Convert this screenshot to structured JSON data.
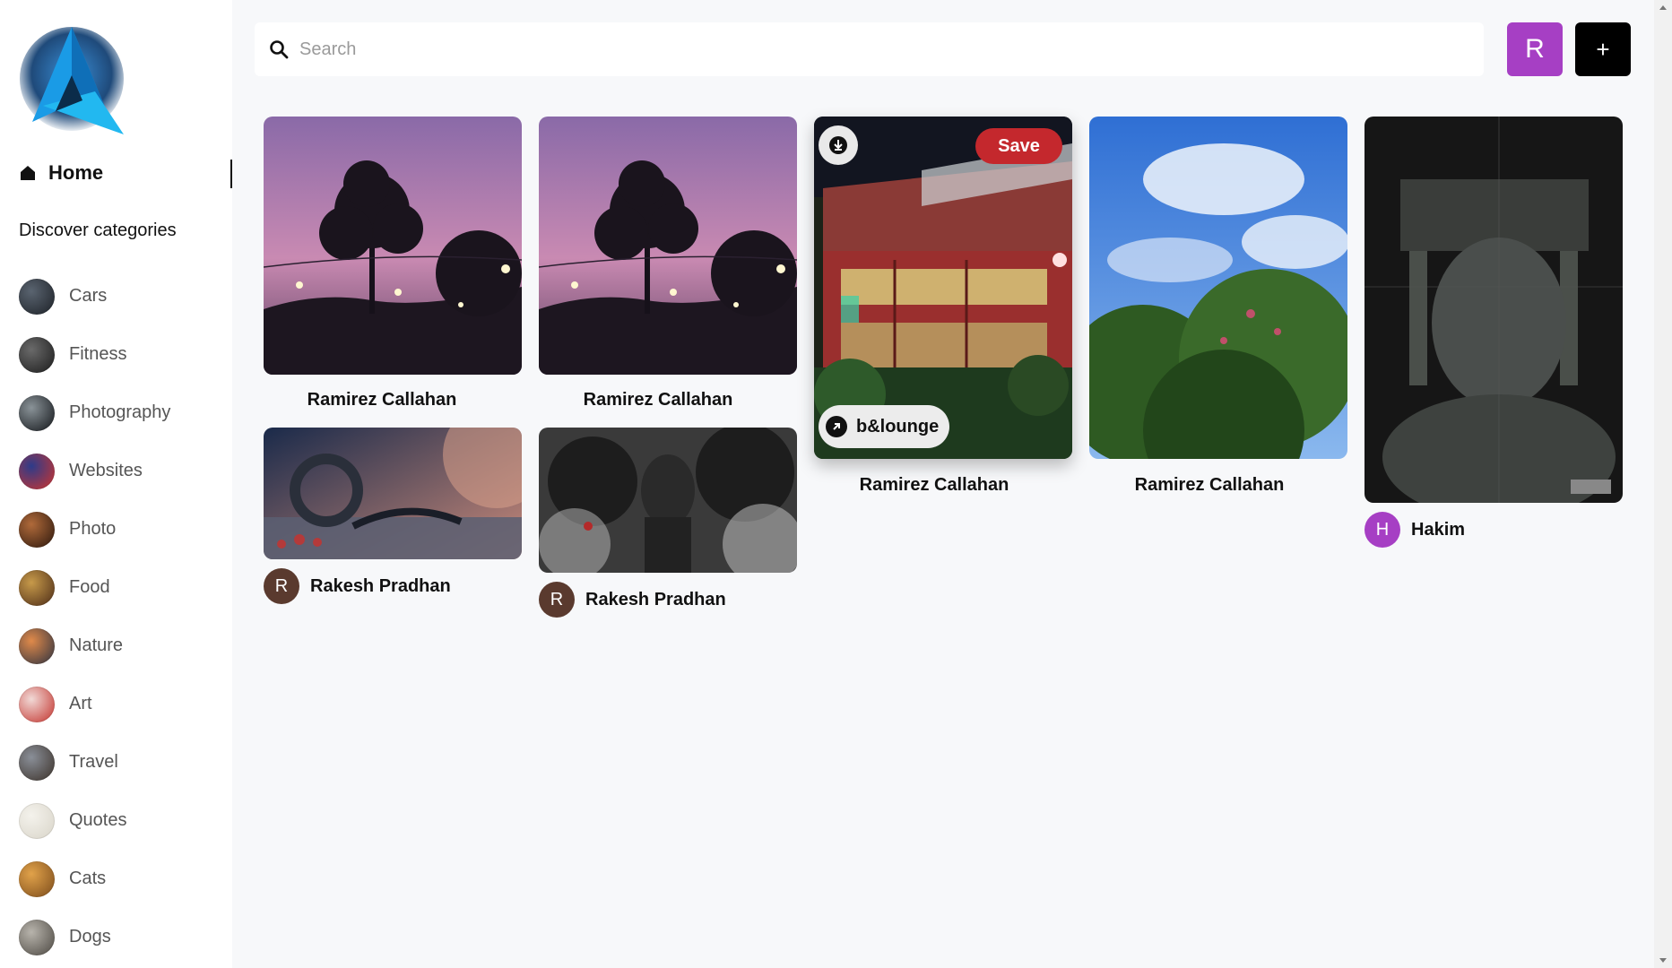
{
  "sidebar": {
    "home_label": "Home",
    "discover_label": "Discover categories",
    "categories": [
      {
        "label": "Cars",
        "icon": "cars-thumbnail",
        "colors": [
          "#5a6470",
          "#1c2026"
        ]
      },
      {
        "label": "Fitness",
        "icon": "fitness-thumbnail",
        "colors": [
          "#6a6a6a",
          "#1a1a1a"
        ]
      },
      {
        "label": "Photography",
        "icon": "photography-thumbnail",
        "colors": [
          "#8a9398",
          "#111418"
        ]
      },
      {
        "label": "Websites",
        "icon": "websites-thumbnail",
        "colors": [
          "#2d3b8a",
          "#d0342c"
        ]
      },
      {
        "label": "Photo",
        "icon": "photo-thumbnail",
        "colors": [
          "#b06a3a",
          "#2a160c"
        ]
      },
      {
        "label": "Food",
        "icon": "food-thumbnail",
        "colors": [
          "#c79a4a",
          "#4a2a16"
        ]
      },
      {
        "label": "Nature",
        "icon": "nature-thumbnail",
        "colors": [
          "#e08a4a",
          "#2a3040"
        ]
      },
      {
        "label": "Art",
        "icon": "art-thumbnail",
        "colors": [
          "#f1d9d6",
          "#c2302a"
        ]
      },
      {
        "label": "Travel",
        "icon": "travel-thumbnail",
        "colors": [
          "#8a8f98",
          "#3a3028"
        ]
      },
      {
        "label": "Quotes",
        "icon": "quotes-thumbnail",
        "colors": [
          "#f4f2ec",
          "#d8d4c8"
        ]
      },
      {
        "label": "Cats",
        "icon": "cats-thumbnail",
        "colors": [
          "#e1a24a",
          "#7a4a1a"
        ]
      },
      {
        "label": "Dogs",
        "icon": "dogs-thumbnail",
        "colors": [
          "#b8b4ac",
          "#4a4640"
        ]
      }
    ]
  },
  "header": {
    "search_placeholder": "Search",
    "user_initial": "R",
    "add_label": "+"
  },
  "pins": {
    "p1": {
      "title": "Ramirez Callahan"
    },
    "p2": {
      "title": "Ramirez Callahan"
    },
    "p3": {
      "title": "Ramirez Callahan",
      "save_label": "Save",
      "link_label": "b&lounge"
    },
    "p4": {
      "title": "Ramirez Callahan"
    },
    "p5": {
      "author_initial": "H",
      "author_name": "Hakim"
    },
    "p6": {
      "author_initial": "R",
      "author_name": "Rakesh Pradhan"
    },
    "p7": {
      "author_initial": "R",
      "author_name": "Rakesh Pradhan"
    }
  },
  "colors": {
    "accent_purple": "#a63fc4",
    "save_red": "#c4282d",
    "author_brown": "#5a3a2e"
  }
}
